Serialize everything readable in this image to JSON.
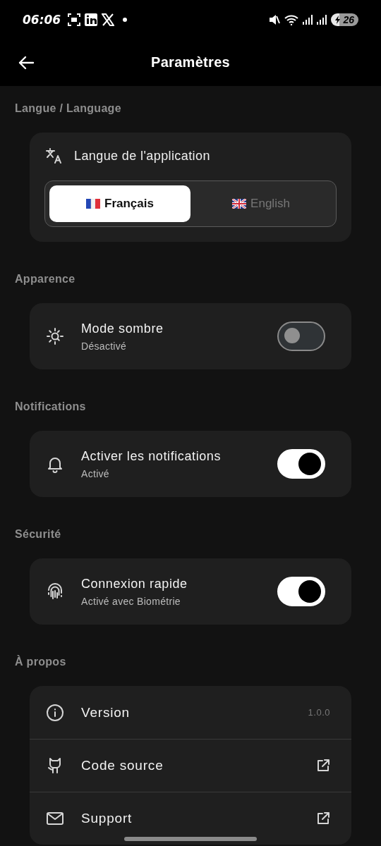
{
  "status_bar": {
    "time": "06:06",
    "battery": "26"
  },
  "header": {
    "title": "Paramètres"
  },
  "sections": [
    {
      "title": "Langue / Language",
      "items": [
        {
          "kind": "language",
          "label": "Langue de l'application",
          "options": [
            {
              "label": "Français",
              "selected": true
            },
            {
              "label": "English",
              "selected": false
            }
          ]
        }
      ]
    },
    {
      "title": "Apparence",
      "items": [
        {
          "kind": "toggle",
          "label": "Mode sombre",
          "subtitle": "Désactivé",
          "on": false
        }
      ]
    },
    {
      "title": "Notifications",
      "items": [
        {
          "kind": "toggle",
          "label": "Activer les notifications",
          "subtitle": "Activé",
          "on": true
        }
      ]
    },
    {
      "title": "Sécurité",
      "items": [
        {
          "kind": "toggle",
          "label": "Connexion rapide",
          "subtitle": "Activé avec Biométrie",
          "on": true
        }
      ]
    },
    {
      "title": "À propos",
      "items": [
        {
          "kind": "info",
          "label": "Version",
          "value": "1.0.0"
        },
        {
          "kind": "link",
          "label": "Code source"
        },
        {
          "kind": "link",
          "label": "Support"
        }
      ]
    }
  ]
}
